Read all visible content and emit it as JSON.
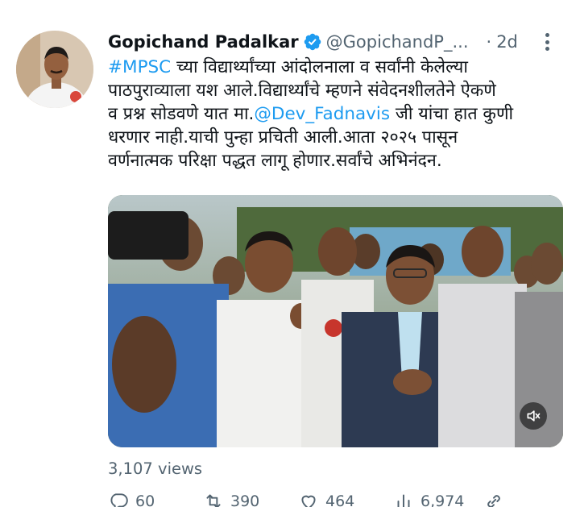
{
  "tweet": {
    "author_name": "Gopichand Padalkar",
    "handle": "@GopichandP_...",
    "separator": "·",
    "time": "2d",
    "text_lines": [
      {
        "link": "#MPSC",
        "rest": " च्या विद्यार्थ्यांच्या आंदोलनाला व सर्वांनी केलेल्या"
      },
      {
        "plain": "पाठपुराव्याला यश आले.विद्यार्थ्यांचे म्हणने संवेदनशीलतेने ऐकणे"
      },
      {
        "before": "व प्रश्न सोडवणे यात मा.",
        "link": "@Dev_Fadnavis",
        "rest": " जी यांचा हात कुणी"
      },
      {
        "plain": "धरणार नाही.याची पुन्हा प्रचिती आली.आता २०२५ पासून"
      },
      {
        "plain": "वर्णनात्मक परिक्षा पद्धत लागू होणार.सर्वांचे अभिनंदन."
      }
    ],
    "views": "3,107 views",
    "actions": {
      "replies": "60",
      "retweets": "390",
      "likes": "464",
      "analytics": "6,974"
    }
  },
  "colors": {
    "link": "#1d9bf0",
    "secondary_text": "#536471",
    "verified": "#1d9bf0"
  },
  "icons": [
    "avatar-photo",
    "verified-badge-icon",
    "more-icon",
    "mute-icon",
    "reply-icon",
    "retweet-icon",
    "like-icon",
    "analytics-icon",
    "share-icon"
  ]
}
